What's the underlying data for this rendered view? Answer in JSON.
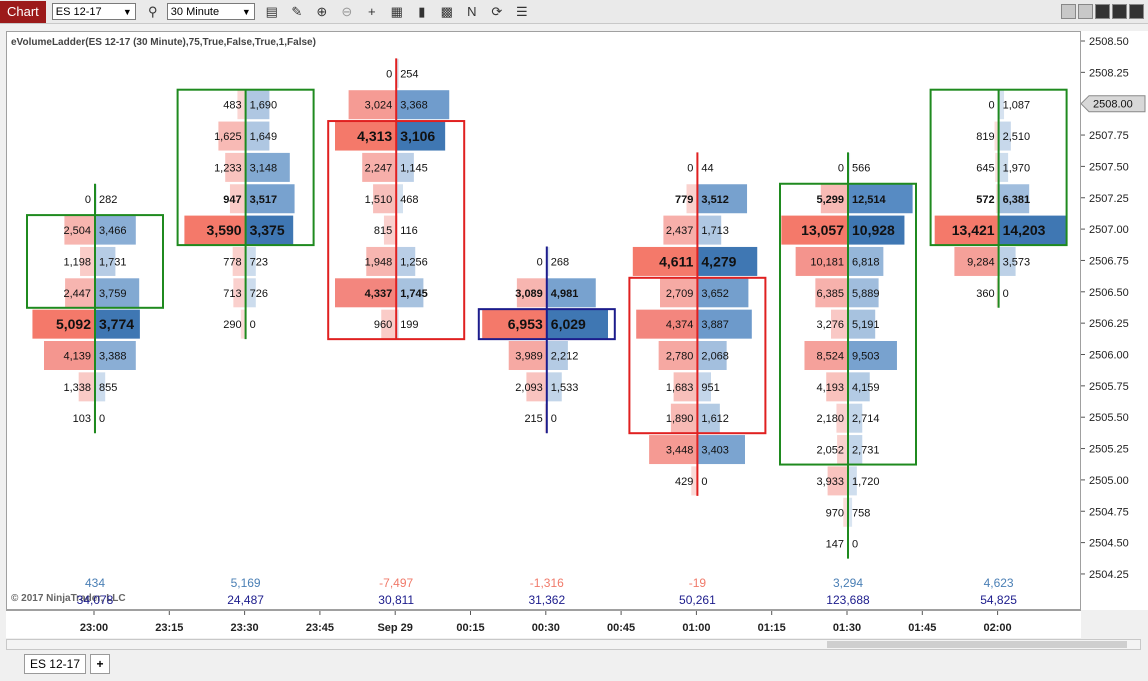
{
  "toolbar": {
    "chart_tab": "Chart",
    "instrument": "ES 12-17",
    "interval": "30 Minute"
  },
  "indicator_label": "eVolumeLadder(ES 12-17 (30 Minute),75,True,False,True,1,False)",
  "copyright": "© 2017 NinjaTrader, LLC",
  "current_price": "2508.00",
  "price_axis": [
    "2508.50",
    "2508.25",
    "2508.00",
    "2507.75",
    "2507.50",
    "2507.25",
    "2507.00",
    "2506.75",
    "2506.50",
    "2506.25",
    "2506.00",
    "2505.75",
    "2505.50",
    "2505.25",
    "2505.00",
    "2504.75",
    "2504.50",
    "2504.25"
  ],
  "time_axis": [
    "23:00",
    "23:15",
    "23:30",
    "23:45",
    "Sep 29",
    "00:15",
    "00:30",
    "00:45",
    "01:00",
    "01:15",
    "01:30",
    "01:45",
    "02:00"
  ],
  "bottom_tab": "ES 12-17",
  "add_tab": "+",
  "colors": {
    "bid": "#f08070",
    "ask": "#4a7fb5",
    "green": "#1f8a1f",
    "red": "#e02020",
    "navy": "#1c1c8c"
  },
  "bars": [
    {
      "time": "23:00",
      "line": "green",
      "delta": "434",
      "delta_color": "pos",
      "volume": "34,078",
      "boxes": [
        {
          "c": "green",
          "from": "2507.00",
          "to": "2506.50"
        }
      ],
      "rows": [
        {
          "p": "2507.25",
          "b": "0",
          "a": "282",
          "bf": 0,
          "af": 0.03
        },
        {
          "p": "2507.00",
          "b": "2,504",
          "a": "3,466",
          "bf": 0.45,
          "af": 0.6
        },
        {
          "p": "2506.75",
          "b": "1,198",
          "a": "1,731",
          "bf": 0.22,
          "af": 0.3
        },
        {
          "p": "2506.50",
          "b": "2,447",
          "a": "3,759",
          "bf": 0.44,
          "af": 0.65
        },
        {
          "p": "2506.25",
          "b": "5,092",
          "a": "3,774",
          "bf": 0.92,
          "af": 0.66,
          "hl": true
        },
        {
          "p": "2506.00",
          "b": "4,139",
          "a": "3,388",
          "bf": 0.75,
          "af": 0.6
        },
        {
          "p": "2505.75",
          "b": "1,338",
          "a": "855",
          "bf": 0.24,
          "af": 0.15
        },
        {
          "p": "2505.50",
          "b": "103",
          "a": "0",
          "bf": 0.02,
          "af": 0
        }
      ]
    },
    {
      "time": "23:30",
      "line": "green",
      "delta": "5,169",
      "delta_color": "pos",
      "volume": "24,487",
      "boxes": [
        {
          "c": "green",
          "from": "2508.00",
          "to": "2507.00"
        }
      ],
      "rows": [
        {
          "p": "2508.00",
          "b": "483",
          "a": "1,690",
          "bf": 0.12,
          "af": 0.35
        },
        {
          "p": "2507.75",
          "b": "1,625",
          "a": "1,649",
          "bf": 0.4,
          "af": 0.35
        },
        {
          "p": "2507.50",
          "b": "1,233",
          "a": "3,148",
          "bf": 0.3,
          "af": 0.65
        },
        {
          "p": "2507.25",
          "b": "947",
          "a": "3,517",
          "bf": 0.23,
          "af": 0.72,
          "bold": true
        },
        {
          "p": "2507.00",
          "b": "3,590",
          "a": "3,375",
          "bf": 0.9,
          "af": 0.7,
          "hl": true
        },
        {
          "p": "2506.75",
          "b": "778",
          "a": "723",
          "bf": 0.19,
          "af": 0.15
        },
        {
          "p": "2506.50",
          "b": "713",
          "a": "726",
          "bf": 0.18,
          "af": 0.15
        },
        {
          "p": "2506.25",
          "b": "290",
          "a": "0",
          "bf": 0.07,
          "af": 0
        }
      ]
    },
    {
      "time": "Sep 29",
      "line": "red",
      "delta": "-7,497",
      "delta_color": "neg",
      "volume": "30,811",
      "boxes": [
        {
          "c": "red",
          "from": "2507.75",
          "to": "2506.25"
        }
      ],
      "rows": [
        {
          "p": "2508.25",
          "b": "0",
          "a": "254",
          "bf": 0,
          "af": 0.04
        },
        {
          "p": "2508.00",
          "b": "3,024",
          "a": "3,368",
          "bf": 0.7,
          "af": 0.78
        },
        {
          "p": "2507.75",
          "b": "4,313",
          "a": "3,106",
          "bf": 0.9,
          "af": 0.72,
          "hl": true
        },
        {
          "p": "2507.50",
          "b": "2,247",
          "a": "1,145",
          "bf": 0.5,
          "af": 0.26
        },
        {
          "p": "2507.25",
          "b": "1,510",
          "a": "468",
          "bf": 0.34,
          "af": 0.1
        },
        {
          "p": "2507.00",
          "b": "815",
          "a": "116",
          "bf": 0.18,
          "af": 0.02
        },
        {
          "p": "2506.75",
          "b": "1,948",
          "a": "1,256",
          "bf": 0.44,
          "af": 0.28
        },
        {
          "p": "2506.50",
          "b": "4,337",
          "a": "1,745",
          "bf": 0.9,
          "af": 0.4,
          "bold": true
        },
        {
          "p": "2506.25",
          "b": "960",
          "a": "199",
          "bf": 0.22,
          "af": 0.04
        }
      ]
    },
    {
      "time": "00:30",
      "line": "navy",
      "delta": "-1,316",
      "delta_color": "neg",
      "volume": "31,362",
      "boxes": [
        {
          "c": "navy",
          "from": "2506.25",
          "to": "2506.25"
        }
      ],
      "rows": [
        {
          "p": "2506.75",
          "b": "0",
          "a": "268",
          "bf": 0,
          "af": 0.04
        },
        {
          "p": "2506.50",
          "b": "3,089",
          "a": "4,981",
          "bf": 0.44,
          "af": 0.72,
          "bold": true
        },
        {
          "p": "2506.25",
          "b": "6,953",
          "a": "6,029",
          "bf": 0.95,
          "af": 0.9,
          "hl": true
        },
        {
          "p": "2506.00",
          "b": "3,989",
          "a": "2,212",
          "bf": 0.56,
          "af": 0.31
        },
        {
          "p": "2505.75",
          "b": "2,093",
          "a": "1,533",
          "bf": 0.3,
          "af": 0.22
        },
        {
          "p": "2505.50",
          "b": "215",
          "a": "0",
          "bf": 0.03,
          "af": 0
        }
      ]
    },
    {
      "time": "01:00",
      "line": "red",
      "delta": "-19",
      "delta_color": "neg",
      "volume": "50,261",
      "boxes": [
        {
          "c": "red",
          "from": "2506.50",
          "to": "2505.50"
        }
      ],
      "rows": [
        {
          "p": "2507.50",
          "b": "0",
          "a": "44",
          "bf": 0,
          "af": 0.01
        },
        {
          "p": "2507.25",
          "b": "779",
          "a": "3,512",
          "bf": 0.16,
          "af": 0.73,
          "bold": true
        },
        {
          "p": "2507.00",
          "b": "2,437",
          "a": "1,713",
          "bf": 0.5,
          "af": 0.35
        },
        {
          "p": "2506.75",
          "b": "4,611",
          "a": "4,279",
          "bf": 0.95,
          "af": 0.88,
          "hl": true
        },
        {
          "p": "2506.50",
          "b": "2,709",
          "a": "3,652",
          "bf": 0.55,
          "af": 0.75
        },
        {
          "p": "2506.25",
          "b": "4,374",
          "a": "3,887",
          "bf": 0.9,
          "af": 0.8
        },
        {
          "p": "2506.00",
          "b": "2,780",
          "a": "2,068",
          "bf": 0.57,
          "af": 0.43
        },
        {
          "p": "2505.75",
          "b": "1,683",
          "a": "951",
          "bf": 0.35,
          "af": 0.2
        },
        {
          "p": "2505.50",
          "b": "1,890",
          "a": "1,612",
          "bf": 0.39,
          "af": 0.33
        },
        {
          "p": "2505.25",
          "b": "3,448",
          "a": "3,403",
          "bf": 0.71,
          "af": 0.7
        },
        {
          "p": "2505.00",
          "b": "429",
          "a": "0",
          "bf": 0.09,
          "af": 0
        }
      ]
    },
    {
      "time": "01:30",
      "line": "green",
      "delta": "3,294",
      "delta_color": "pos",
      "volume": "123,688",
      "boxes": [
        {
          "c": "green",
          "from": "2507.25",
          "to": "2505.25"
        }
      ],
      "rows": [
        {
          "p": "2507.50",
          "b": "0",
          "a": "566",
          "bf": 0,
          "af": 0.03
        },
        {
          "p": "2507.25",
          "b": "5,299",
          "a": "12,514",
          "bf": 0.4,
          "af": 0.95,
          "bold": true
        },
        {
          "p": "2507.00",
          "b": "13,057",
          "a": "10,928",
          "bf": 0.98,
          "af": 0.83,
          "hl": true
        },
        {
          "p": "2506.75",
          "b": "10,181",
          "a": "6,818",
          "bf": 0.77,
          "af": 0.52
        },
        {
          "p": "2506.50",
          "b": "6,385",
          "a": "5,889",
          "bf": 0.48,
          "af": 0.45
        },
        {
          "p": "2506.25",
          "b": "3,276",
          "a": "5,191",
          "bf": 0.25,
          "af": 0.4
        },
        {
          "p": "2506.00",
          "b": "8,524",
          "a": "9,503",
          "bf": 0.64,
          "af": 0.72
        },
        {
          "p": "2505.75",
          "b": "4,193",
          "a": "4,159",
          "bf": 0.32,
          "af": 0.32
        },
        {
          "p": "2505.50",
          "b": "2,180",
          "a": "2,714",
          "bf": 0.17,
          "af": 0.21
        },
        {
          "p": "2505.25",
          "b": "2,052",
          "a": "2,731",
          "bf": 0.16,
          "af": 0.21
        },
        {
          "p": "2505.00",
          "b": "3,933",
          "a": "1,720",
          "bf": 0.3,
          "af": 0.13
        },
        {
          "p": "2504.75",
          "b": "970",
          "a": "758",
          "bf": 0.07,
          "af": 0.06
        },
        {
          "p": "2504.50",
          "b": "147",
          "a": "0",
          "bf": 0.01,
          "af": 0
        }
      ]
    },
    {
      "time": "02:00",
      "line": "green",
      "delta": "4,623",
      "delta_color": "pos",
      "volume": "54,825",
      "boxes": [
        {
          "c": "green",
          "from": "2508.00",
          "to": "2507.00"
        }
      ],
      "rows": [
        {
          "p": "2508.00",
          "b": "0",
          "a": "1,087",
          "bf": 0,
          "af": 0.08
        },
        {
          "p": "2507.75",
          "b": "819",
          "a": "2,510",
          "bf": 0.06,
          "af": 0.18
        },
        {
          "p": "2507.50",
          "b": "645",
          "a": "1,970",
          "bf": 0.05,
          "af": 0.14
        },
        {
          "p": "2507.25",
          "b": "572",
          "a": "6,381",
          "bf": 0.04,
          "af": 0.45,
          "bold": true
        },
        {
          "p": "2507.00",
          "b": "13,421",
          "a": "14,203",
          "bf": 0.94,
          "af": 0.99,
          "hl": true
        },
        {
          "p": "2506.75",
          "b": "9,284",
          "a": "3,573",
          "bf": 0.65,
          "af": 0.25
        },
        {
          "p": "2506.50",
          "b": "360",
          "a": "0",
          "bf": 0.03,
          "af": 0
        }
      ]
    }
  ]
}
